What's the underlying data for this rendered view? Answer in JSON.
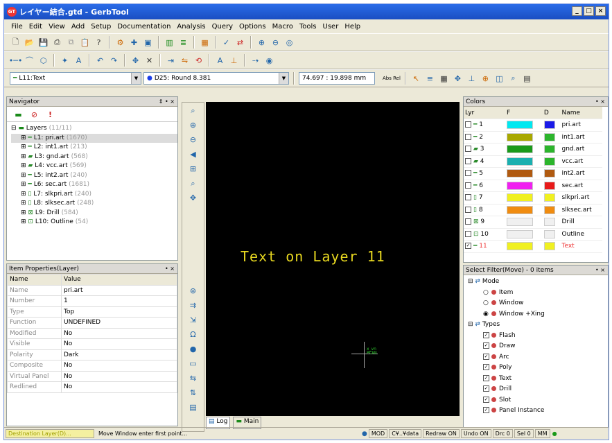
{
  "title": "レイヤー結合.gtd - GerbTool",
  "app_icon": "GT",
  "title_controls": [
    "_",
    "□",
    "×"
  ],
  "menu": [
    "File",
    "Edit",
    "View",
    "Add",
    "Setup",
    "Documentation",
    "Analysis",
    "Query",
    "Options",
    "Macro",
    "Tools",
    "User",
    "Help"
  ],
  "layer_combo": "L11:Text",
  "aperture_combo": "D25: Round 8.381",
  "coords": "74.697 : 19.898 mm",
  "abs_rel": "Abs Rel",
  "navigator": {
    "title": "Navigator",
    "controls": "⇕ • ×",
    "root": "Layers",
    "root_count": "(11/11)",
    "items": [
      {
        "label": "L1: pri.art",
        "count": "(1670)"
      },
      {
        "label": "L2: int1.art",
        "count": "(213)"
      },
      {
        "label": "L3: gnd.art",
        "count": "(568)"
      },
      {
        "label": "L4: vcc.art",
        "count": "(569)"
      },
      {
        "label": "L5: int2.art",
        "count": "(240)"
      },
      {
        "label": "L6: sec.art",
        "count": "(1681)"
      },
      {
        "label": "L7: slkpri.art",
        "count": "(240)"
      },
      {
        "label": "L8: slksec.art",
        "count": "(248)"
      },
      {
        "label": "L9: Drill",
        "count": "(584)"
      },
      {
        "label": "L10: Outline",
        "count": "(54)"
      }
    ]
  },
  "props": {
    "title": "Item Properties(Layer)",
    "controls": "• ×",
    "col_name": "Name",
    "col_value": "Value",
    "rows": [
      {
        "k": "Name",
        "v": "pri.art"
      },
      {
        "k": "Number",
        "v": "1"
      },
      {
        "k": "Type",
        "v": "Top"
      },
      {
        "k": "Function",
        "v": "UNDEFINED"
      },
      {
        "k": "Modified",
        "v": "No"
      },
      {
        "k": "Visible",
        "v": "No"
      },
      {
        "k": "Polarity",
        "v": "Dark"
      },
      {
        "k": "Composite",
        "v": "No"
      },
      {
        "k": "Virtual Panel",
        "v": "No"
      },
      {
        "k": "Redlined",
        "v": "No"
      }
    ]
  },
  "canvas": {
    "text": "Text on Layer 11",
    "cross_label_1": "x_vn",
    "cross_label_2": "PCMI"
  },
  "tabs": {
    "log": "Log",
    "main": "Main"
  },
  "colors_panel": {
    "title": "Colors",
    "controls": "• ×",
    "headers": [
      "Lyr",
      "F",
      "D",
      "Name"
    ],
    "rows": [
      {
        "n": "1",
        "f": "#00e8f0",
        "d": "#1a1ae8",
        "name": "pri.art"
      },
      {
        "n": "2",
        "f": "#a8a800",
        "d": "#2cb52c",
        "name": "int1.art"
      },
      {
        "n": "3",
        "f": "#1a9a1a",
        "d": "#2cb52c",
        "name": "gnd.art"
      },
      {
        "n": "4",
        "f": "#1ab0b0",
        "d": "#2cb52c",
        "name": "vcc.art"
      },
      {
        "n": "5",
        "f": "#b05a10",
        "d": "#b05a10",
        "name": "int2.art"
      },
      {
        "n": "6",
        "f": "#f020f0",
        "d": "#e81a1a",
        "name": "sec.art"
      },
      {
        "n": "7",
        "f": "#f0f020",
        "d": "#f0f020",
        "name": "slkpri.art"
      },
      {
        "n": "8",
        "f": "#f08c10",
        "d": "#f08c10",
        "name": "slksec.art"
      },
      {
        "n": "9",
        "f": "#f0f0f0",
        "d": "#f0f0f0",
        "name": "Drill"
      },
      {
        "n": "10",
        "f": "#f0f0f0",
        "d": "#f0f0f0",
        "name": "Outline"
      },
      {
        "n": "11",
        "f": "#f0f020",
        "d": "#f0f020",
        "name": "Text"
      }
    ]
  },
  "filter": {
    "title": "Select Filter(Move) - 0 items",
    "controls": "• ×",
    "mode": "Mode",
    "mode_items": [
      "Item",
      "Window",
      "Window +Xing"
    ],
    "types": "Types",
    "type_items": [
      "Flash",
      "Draw",
      "Arc",
      "Poly",
      "Text",
      "Drill",
      "Slot",
      "Panel Instance"
    ]
  },
  "status": {
    "dest": "Destination Layer(D)...",
    "msg": "Move Window enter first point...",
    "items": [
      "MOD",
      "C¥..¥data",
      "Redraw ON",
      "Undo ON",
      "Drc 0",
      "Sel 0",
      "MM"
    ]
  }
}
